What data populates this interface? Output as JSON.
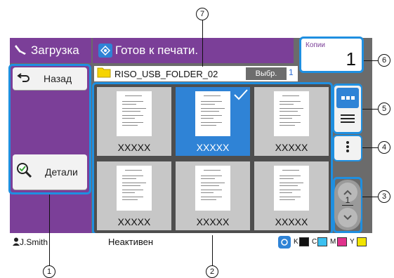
{
  "header": {
    "mode_label": "Загрузка",
    "status_label": "Готов к печати.",
    "mode_icon": "upload-icon",
    "status_icon": "status-diamond-icon"
  },
  "copies": {
    "label": "Копии",
    "value": "1"
  },
  "left": {
    "back_label": "Назад",
    "back_icon": "back-arrow-icon",
    "details_label": "Детали",
    "details_icon": "magnifier-check-icon"
  },
  "folder": {
    "name": "RISO_USB_FOLDER_02",
    "select_label": "Выбр.",
    "selected_count": "1",
    "icon": "folder-icon"
  },
  "files": [
    {
      "name": "XXXXX",
      "selected": false
    },
    {
      "name": "XXXXX",
      "selected": true
    },
    {
      "name": "XXXXX",
      "selected": false
    },
    {
      "name": "XXXXX",
      "selected": false
    },
    {
      "name": "XXXXX",
      "selected": false
    },
    {
      "name": "XXXXX",
      "selected": false
    }
  ],
  "view": {
    "grid_icon": "grid-view-icon",
    "list_icon": "list-view-icon",
    "menu_icon": "more-vertical-icon"
  },
  "pager": {
    "current": "1",
    "total": "1",
    "up_icon": "chevron-up-icon",
    "down_icon": "chevron-down-icon"
  },
  "status_bar": {
    "user": "J.Smith",
    "state": "Неактивен",
    "ink_labels": [
      "K",
      "C",
      "M",
      "Y"
    ],
    "ink_colors": [
      "#111111",
      "#3cc0f0",
      "#e0328c",
      "#f2e400"
    ]
  },
  "callouts": [
    "1",
    "2",
    "3",
    "4",
    "5",
    "6",
    "7"
  ],
  "colors": {
    "accent": "#7b3f98",
    "highlight": "#1f8fe0",
    "select": "#2f83d6"
  }
}
